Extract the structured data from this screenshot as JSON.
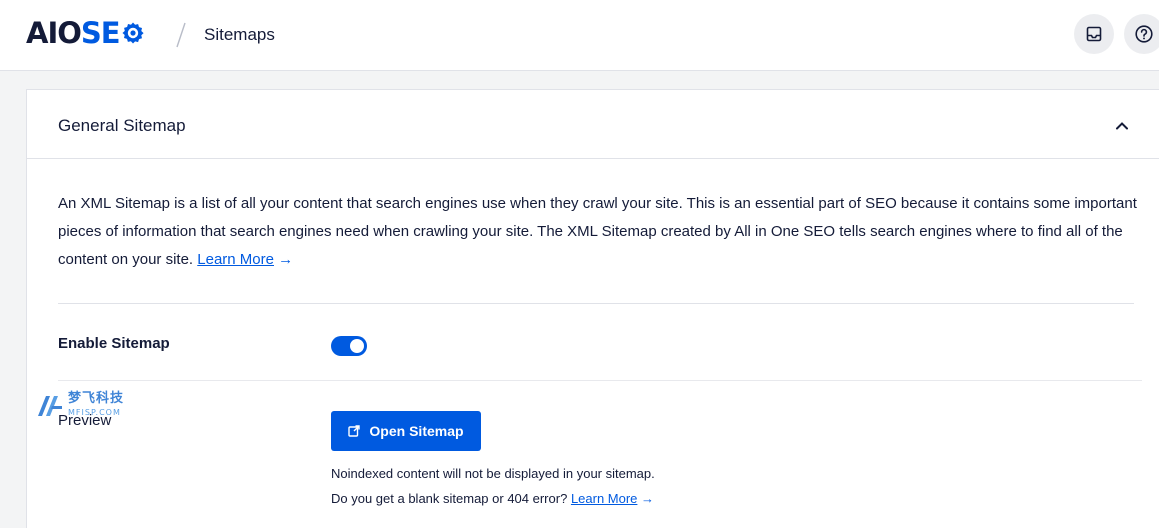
{
  "header": {
    "logo_aio": "AIO",
    "logo_seo": "SE",
    "page_name": "Sitemaps",
    "icons": [
      "inbox-icon",
      "help-icon"
    ]
  },
  "card": {
    "title": "General Sitemap",
    "description": "An XML Sitemap is a list of all your content that search engines use when they crawl your site. This is an essential part of SEO because it contains some important pieces of information that search engines need when crawling your site. The XML Sitemap created by All in One SEO tells search engines where to find all of the content on your site.",
    "learn_more": "Learn More",
    "arrow": "→",
    "enable_label": "Enable Sitemap",
    "enable_on": true,
    "preview_label": "Preview",
    "open_button": "Open Sitemap",
    "note1": "Noindexed content will not be displayed in your sitemap.",
    "note2": "Do you get a blank sitemap or 404 error?",
    "note2_link": "Learn More"
  },
  "watermark": {
    "cn": "梦飞科技",
    "url": "MFISP.COM"
  },
  "colors": {
    "accent": "#005ae0",
    "text": "#141b38",
    "border": "#e0e2e8"
  }
}
